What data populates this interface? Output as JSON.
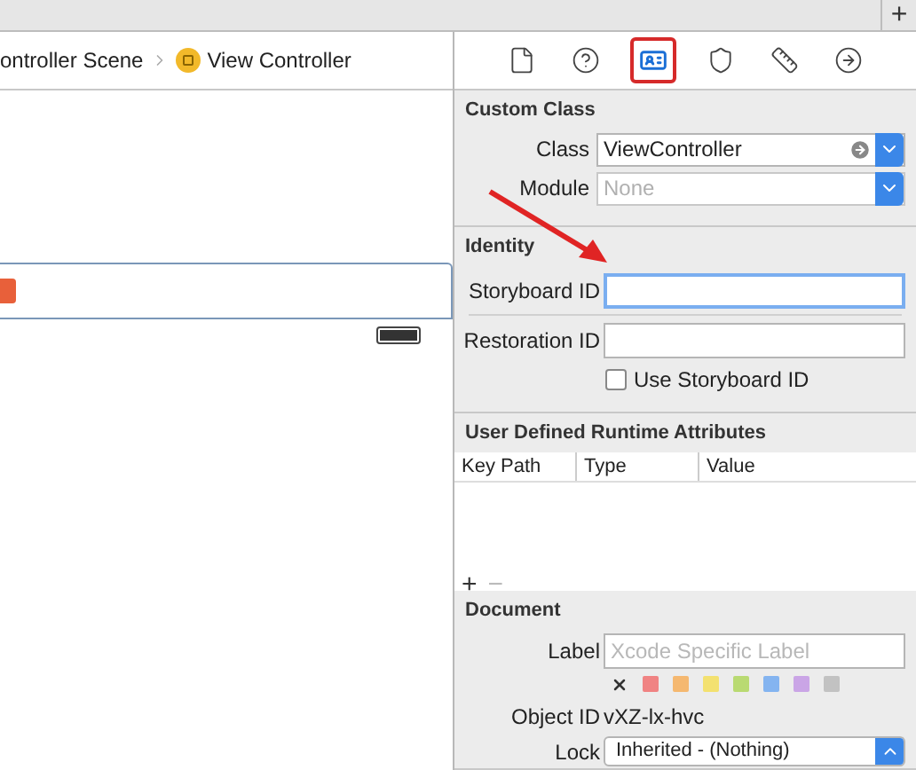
{
  "titlebar": {
    "add_button": "+"
  },
  "breadcrumb": [
    {
      "label": "ontroller Scene",
      "kind": "text"
    },
    {
      "label": "View Controller",
      "kind": "controller"
    }
  ],
  "inspector_tabs": [
    {
      "kind": "file",
      "selected": false
    },
    {
      "kind": "help",
      "selected": false
    },
    {
      "kind": "identity",
      "selected": true
    },
    {
      "kind": "attributes",
      "selected": false
    },
    {
      "kind": "size",
      "selected": false
    },
    {
      "kind": "connections",
      "selected": false
    }
  ],
  "custom_class": {
    "title": "Custom Class",
    "class_label": "Class",
    "class_value": "ViewController",
    "module_label": "Module",
    "module_placeholder": "None"
  },
  "identity": {
    "title": "Identity",
    "storyboard_label": "Storyboard ID",
    "storyboard_focused": true,
    "restoration_label": "Restoration ID",
    "use_storyboard": {
      "label": "Use Storyboard ID",
      "checked": false
    }
  },
  "runtime_attributes": {
    "title": "User Defined Runtime Attributes",
    "columns": [
      "Key Path",
      "Type",
      "Value"
    ],
    "add": "+",
    "remove": "−"
  },
  "document": {
    "title": "Document",
    "label_label": "Label",
    "label_placeholder": "Xcode Specific Label",
    "label_colors": [
      {
        "color": "#f08383"
      },
      {
        "color": "#f5b870"
      },
      {
        "color": "#f3e170"
      },
      {
        "color": "#b9da72"
      },
      {
        "color": "#84b4f0"
      },
      {
        "color": "#caa5e6"
      },
      {
        "color": "#c2c2c2"
      }
    ],
    "object_id_label": "Object ID",
    "object_id": "vXZ-lx-hvc",
    "lock_label": "Lock",
    "lock_value": "Inherited - (Nothing)"
  }
}
